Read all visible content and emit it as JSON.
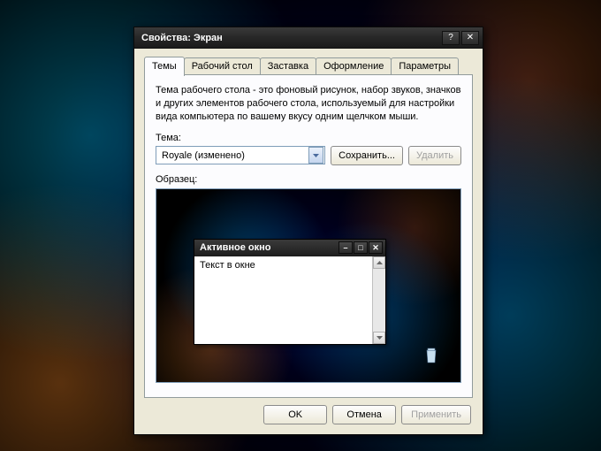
{
  "dialog": {
    "title": "Свойства: Экран",
    "tabs": [
      "Темы",
      "Рабочий стол",
      "Заставка",
      "Оформление",
      "Параметры"
    ],
    "active_tab": 0,
    "description": "Тема рабочего стола - это фоновый рисунок, набор звуков, значков и других элементов рабочего стола, используемый для настройки вида компьютера по вашему вкусу одним щелчком мыши.",
    "theme_label": "Тема:",
    "theme_select": {
      "value": "Royale (изменено)"
    },
    "save_button": "Сохранить...",
    "delete_button": "Удалить",
    "sample_label": "Образец:",
    "sample_window": {
      "title": "Активное окно",
      "body_text": "Текст в окне"
    },
    "buttons": {
      "ok": "OK",
      "cancel": "Отмена",
      "apply": "Применить"
    }
  }
}
